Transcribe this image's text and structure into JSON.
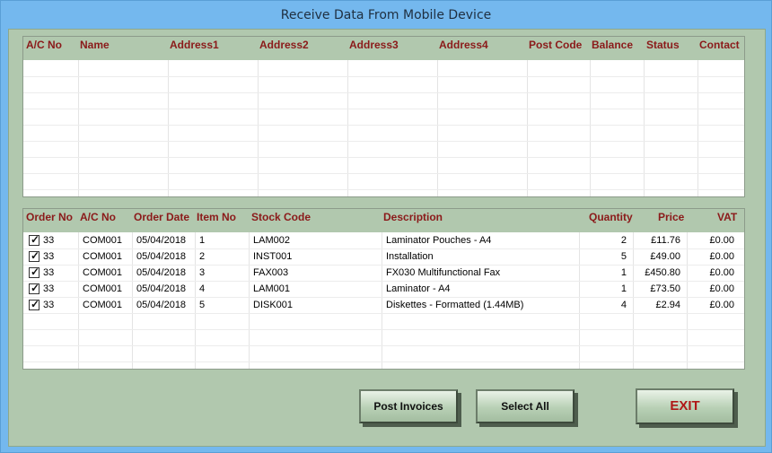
{
  "window": {
    "title": "Receive Data From Mobile Device"
  },
  "accounts_grid": {
    "columns": [
      "A/C No",
      "Name",
      "Address1",
      "Address2",
      "Address3",
      "Address4",
      "Post Code",
      "Balance",
      "Status",
      "Contact"
    ],
    "rows": []
  },
  "orders_grid": {
    "columns": [
      "Order No",
      "A/C No",
      "Order Date",
      "Item No",
      "Stock Code",
      "Description",
      "Quantity",
      "Price",
      "VAT"
    ],
    "rows": [
      {
        "checked": true,
        "order_no": "33",
        "ac_no": "COM001",
        "order_date": "05/04/2018",
        "item_no": "1",
        "stock_code": "LAM002",
        "description": "Laminator Pouches - A4",
        "quantity": "2",
        "price": "£11.76",
        "vat": "£0.00"
      },
      {
        "checked": true,
        "order_no": "33",
        "ac_no": "COM001",
        "order_date": "05/04/2018",
        "item_no": "2",
        "stock_code": "INST001",
        "description": "Installation",
        "quantity": "5",
        "price": "£49.00",
        "vat": "£0.00"
      },
      {
        "checked": true,
        "order_no": "33",
        "ac_no": "COM001",
        "order_date": "05/04/2018",
        "item_no": "3",
        "stock_code": "FAX003",
        "description": "FX030 Multifunctional Fax",
        "quantity": "1",
        "price": "£450.80",
        "vat": "£0.00"
      },
      {
        "checked": true,
        "order_no": "33",
        "ac_no": "COM001",
        "order_date": "05/04/2018",
        "item_no": "4",
        "stock_code": "LAM001",
        "description": "Laminator - A4",
        "quantity": "1",
        "price": "£73.50",
        "vat": "£0.00"
      },
      {
        "checked": true,
        "order_no": "33",
        "ac_no": "COM001",
        "order_date": "05/04/2018",
        "item_no": "5",
        "stock_code": "DISK001",
        "description": "Diskettes - Formatted (1.44MB)",
        "quantity": "4",
        "price": "£2.94",
        "vat": "£0.00"
      }
    ]
  },
  "buttons": {
    "post_invoices": "Post Invoices",
    "select_all": "Select All",
    "exit": "EXIT"
  }
}
